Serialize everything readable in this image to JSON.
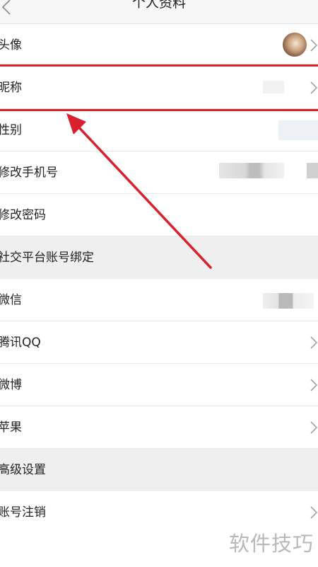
{
  "header": {
    "title": "个人资料",
    "back_icon": "chevron-left-icon"
  },
  "rows": {
    "avatar": "头像",
    "nickname": "昵称",
    "gender": "性别",
    "change_phone": "修改手机号",
    "change_password": "修改密码",
    "section_social": "社交平台账号绑定",
    "wechat": "微信",
    "qq": "腾讯QQ",
    "weibo": "微博",
    "apple": "苹果",
    "section_advanced": "高级设置",
    "deactivate": "账号注销"
  },
  "annotation": {
    "color": "#d9202f"
  },
  "watermark": "软件技巧"
}
